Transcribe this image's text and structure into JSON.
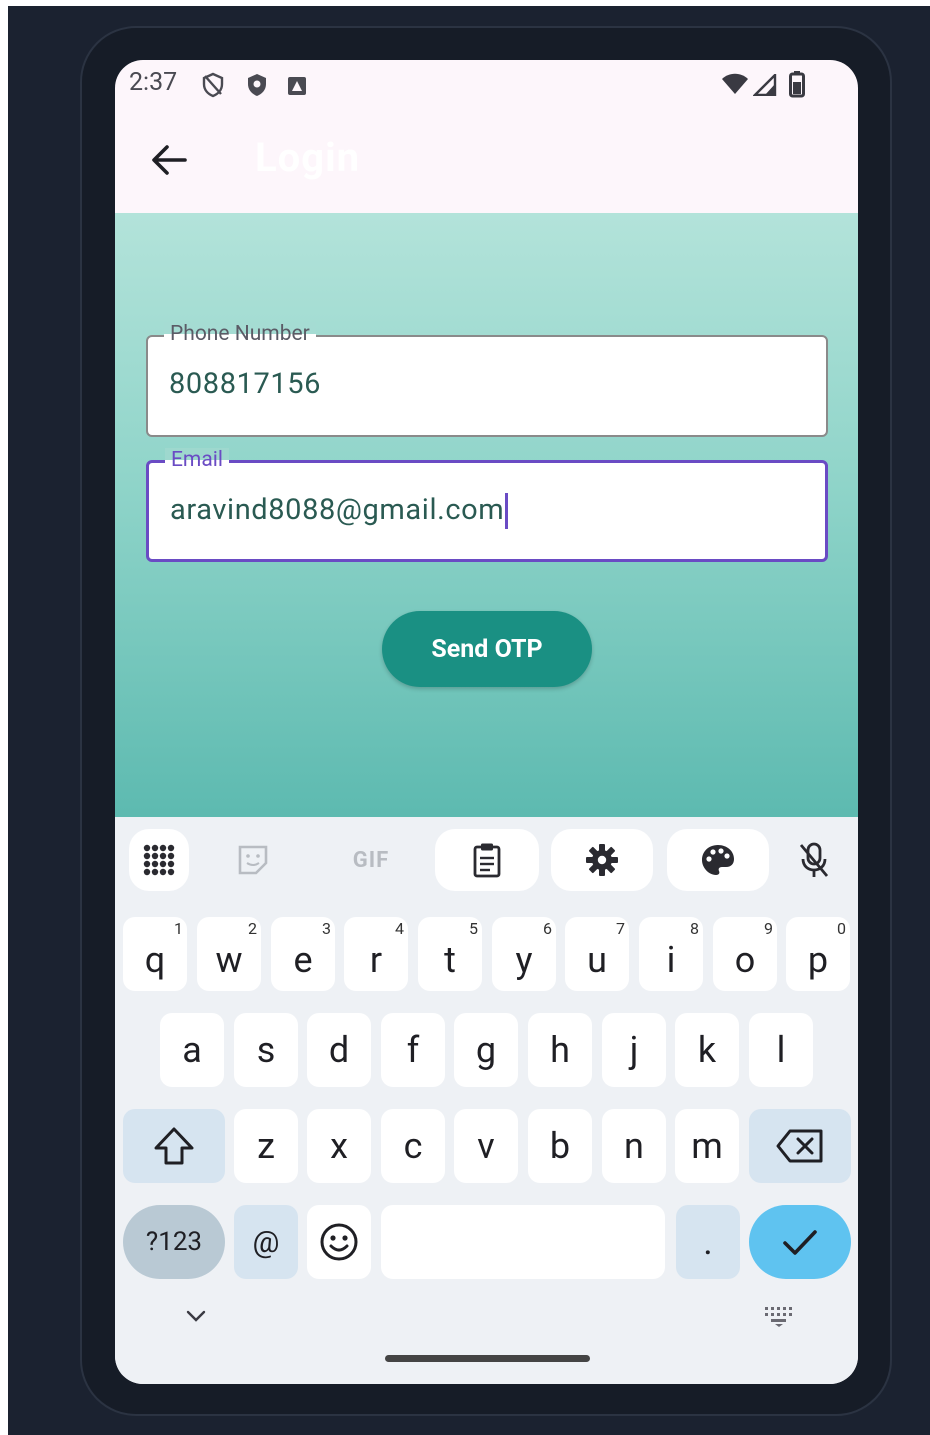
{
  "status_bar": {
    "time": "2:37"
  },
  "app_bar": {
    "title": "Login",
    "back_icon": "arrow-back-icon"
  },
  "form": {
    "phone": {
      "label": "Phone Number",
      "value": "808817156"
    },
    "email": {
      "label": "Email",
      "value": "aravind8088@gmail.com"
    },
    "send_otp_label": "Send OTP"
  },
  "keyboard": {
    "toolbar": {
      "gif_label": "GIF"
    },
    "row1": [
      {
        "label": "q",
        "hint": "1"
      },
      {
        "label": "w",
        "hint": "2"
      },
      {
        "label": "e",
        "hint": "3"
      },
      {
        "label": "r",
        "hint": "4"
      },
      {
        "label": "t",
        "hint": "5"
      },
      {
        "label": "y",
        "hint": "6"
      },
      {
        "label": "u",
        "hint": "7"
      },
      {
        "label": "i",
        "hint": "8"
      },
      {
        "label": "o",
        "hint": "9"
      },
      {
        "label": "p",
        "hint": "0"
      }
    ],
    "row2": [
      "a",
      "s",
      "d",
      "f",
      "g",
      "h",
      "j",
      "k",
      "l"
    ],
    "row3": [
      "z",
      "x",
      "c",
      "v",
      "b",
      "n",
      "m"
    ],
    "row4": {
      "symbols_label": "?123",
      "at_label": "@",
      "period_label": "."
    }
  },
  "colors": {
    "accent": "#1a9083",
    "focus": "#6a4bc4",
    "enter_key": "#5fc3f0"
  }
}
